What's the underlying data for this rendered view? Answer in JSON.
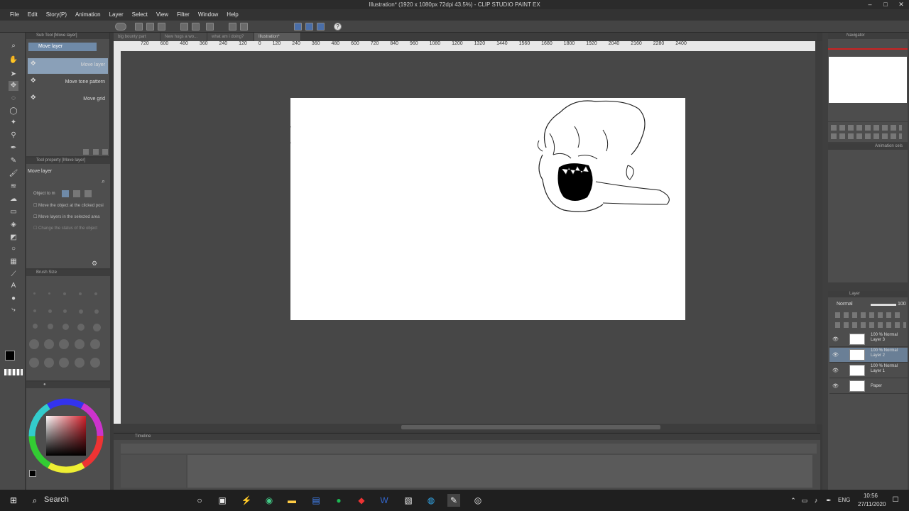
{
  "window": {
    "title": "Illustration* (1920 x 1080px 72dpi 43.5%) - CLIP STUDIO PAINT EX"
  },
  "menu": [
    "File",
    "Edit",
    "Story(P)",
    "Animation",
    "Layer",
    "Select",
    "View",
    "Filter",
    "Window",
    "Help"
  ],
  "tabs": [
    "big bounty part",
    "New hugs a wo...",
    "what am i doing?",
    "Illustration*"
  ],
  "ruler_top": "720 600 480 360 240 120 0 120 240 360 480 600 720 840 960 1080 1200 1320 1440 1560 1680 1800 1920 2040 2160 2280 2400",
  "subtool": {
    "header": "Sub Tool [Move layer]",
    "group": "Move layer",
    "items": [
      "Move layer",
      "Move tone pattern",
      "Move grid"
    ]
  },
  "toolprop": {
    "header": "Tool property [Move layer]",
    "title": "Move layer",
    "object_label": "Object to m",
    "options": [
      "Move the object at the clicked posi",
      "Move layers in the selected area",
      "Change the status of the object"
    ]
  },
  "brushsize": {
    "header": "Brush Size"
  },
  "navigator": {
    "header": "Navigator"
  },
  "layer_panel": {
    "header": "Layer",
    "blend": "Normal",
    "opacity": "100",
    "layers": [
      {
        "line1": "100 % Normal",
        "line2": "Layer 3"
      },
      {
        "line1": "100 % Normal",
        "line2": "Layer 2"
      },
      {
        "line1": "100 % Normal",
        "line2": "Layer 1"
      },
      {
        "line1": "",
        "line2": "Paper"
      }
    ]
  },
  "animation_cels": {
    "header": "Animation cels"
  },
  "timeline": {
    "header": "Timeline"
  },
  "taskbar": {
    "search": "Search",
    "lang": "ENG",
    "time": "10:56",
    "date": "27/11/2020"
  },
  "colors": {
    "main": "#000000",
    "sub": "#ffffff",
    "accent_hue": "#d21f2a"
  }
}
